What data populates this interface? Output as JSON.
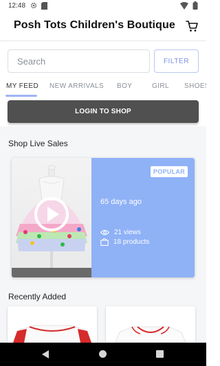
{
  "status_bar": {
    "time": "12:48"
  },
  "header": {
    "title": "Posh Tots Children's Boutique"
  },
  "search": {
    "placeholder": "Search",
    "value": ""
  },
  "filter_label": "FILTER",
  "tabs": [
    {
      "label": "MY FEED",
      "active": true
    },
    {
      "label": "NEW ARRIVALS",
      "active": false
    },
    {
      "label": "BOY",
      "active": false
    },
    {
      "label": "GIRL",
      "active": false
    },
    {
      "label": "SHOES",
      "active": false
    }
  ],
  "login_label": "LOGIN TO SHOP",
  "live_sales": {
    "title": "Shop Live Sales",
    "card": {
      "badge": "POPULAR",
      "time_ago": "65 days ago",
      "views": "21 views",
      "products": "18 products"
    }
  },
  "recently_added": {
    "title": "Recently Added"
  },
  "colors": {
    "accent": "#8fb1f6",
    "filter_text": "#7a8fe6",
    "tab_underline": "#9fb3f3",
    "login_bg": "#505050",
    "content_bg": "#f5f6f8"
  }
}
